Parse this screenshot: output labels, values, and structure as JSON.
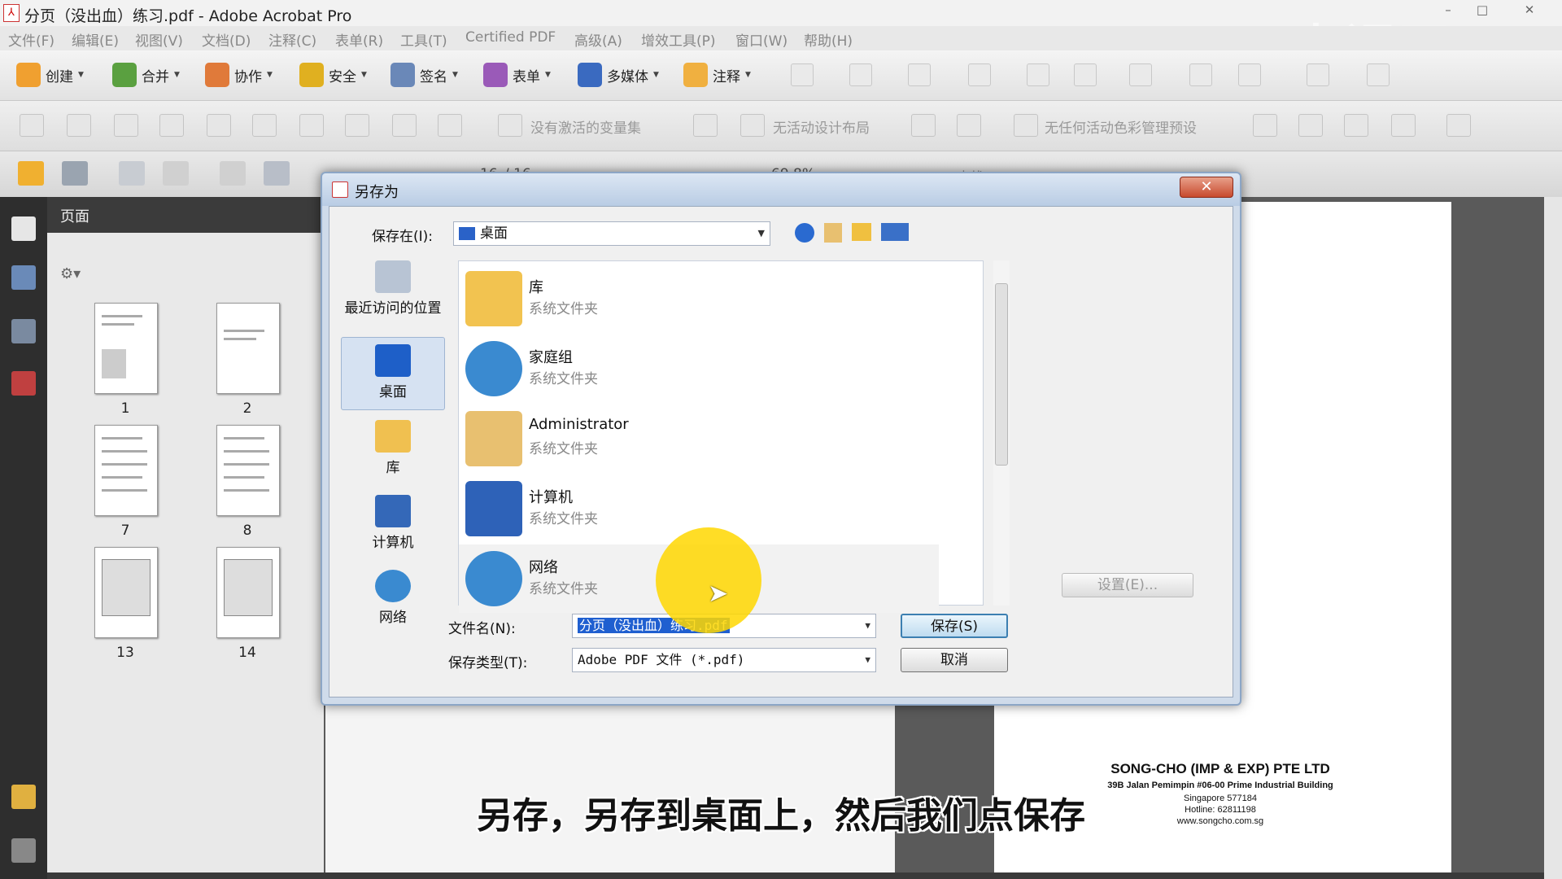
{
  "window": {
    "title": "分页（没出血）练习.pdf - Adobe Acrobat Pro",
    "controls": [
      "–",
      "□",
      "✕"
    ]
  },
  "watermark": "虎课网",
  "menu": [
    "文件(F)",
    "编辑(E)",
    "视图(V)",
    "文档(D)",
    "注释(C)",
    "表单(R)",
    "工具(T)",
    "Certified PDF",
    "高级(A)",
    "增效工具(P)",
    "窗口(W)",
    "帮助(H)"
  ],
  "toolbar1": {
    "create": "创建",
    "combine": "合并",
    "collaborate": "协作",
    "secure": "安全",
    "sign": "签名",
    "forms": "表单",
    "multimedia": "多媒体",
    "comment": "注释"
  },
  "toolbar2": {
    "varset": "没有激活的变量集",
    "layout": "无活动设计布局",
    "colorpreset": "无任何活动色彩管理预设"
  },
  "toolbar3": {
    "page": "16",
    "pages": "/ 16",
    "zoom": "69.8%",
    "find": "查找"
  },
  "panel": {
    "title": "页面",
    "thumbs": [
      "1",
      "2",
      "7",
      "8",
      "13",
      "14"
    ]
  },
  "dialog": {
    "title": "另存为",
    "close": "✕",
    "save_in_label": "保存在(I):",
    "save_in_value": "桌面",
    "places": [
      "最近访问的位置",
      "桌面",
      "库",
      "计算机",
      "网络"
    ],
    "files": [
      {
        "name": "库",
        "type": "系统文件夹"
      },
      {
        "name": "家庭组",
        "type": "系统文件夹"
      },
      {
        "name": "Administrator",
        "type": "系统文件夹"
      },
      {
        "name": "计算机",
        "type": "系统文件夹"
      },
      {
        "name": "网络",
        "type": "系统文件夹"
      }
    ],
    "filename_label": "文件名(N):",
    "filename_value": "分页（没出血）练习.pdf",
    "filetype_label": "保存类型(T):",
    "filetype_value": "Adobe PDF 文件 (*.pdf)",
    "save_button": "保存(S)",
    "cancel_button": "取消",
    "settings_button": "设置(E)..."
  },
  "document": {
    "company": "SONG-CHO (IMP & EXP) PTE LTD",
    "address": "39B Jalan Pemimpin #06-00 Prime Industrial Building",
    "city": "Singapore 577184",
    "hotline": "Hotline: 62811198",
    "web": "www.songcho.com.sg"
  },
  "subtitle": "另存，另存到桌面上，然后我们点保存",
  "colors": {
    "dialog_frame": "#cfdbea",
    "accent_blue": "#1f5fd0",
    "cursor_spot": "#ffd700",
    "close_red": "#c84a2e"
  }
}
